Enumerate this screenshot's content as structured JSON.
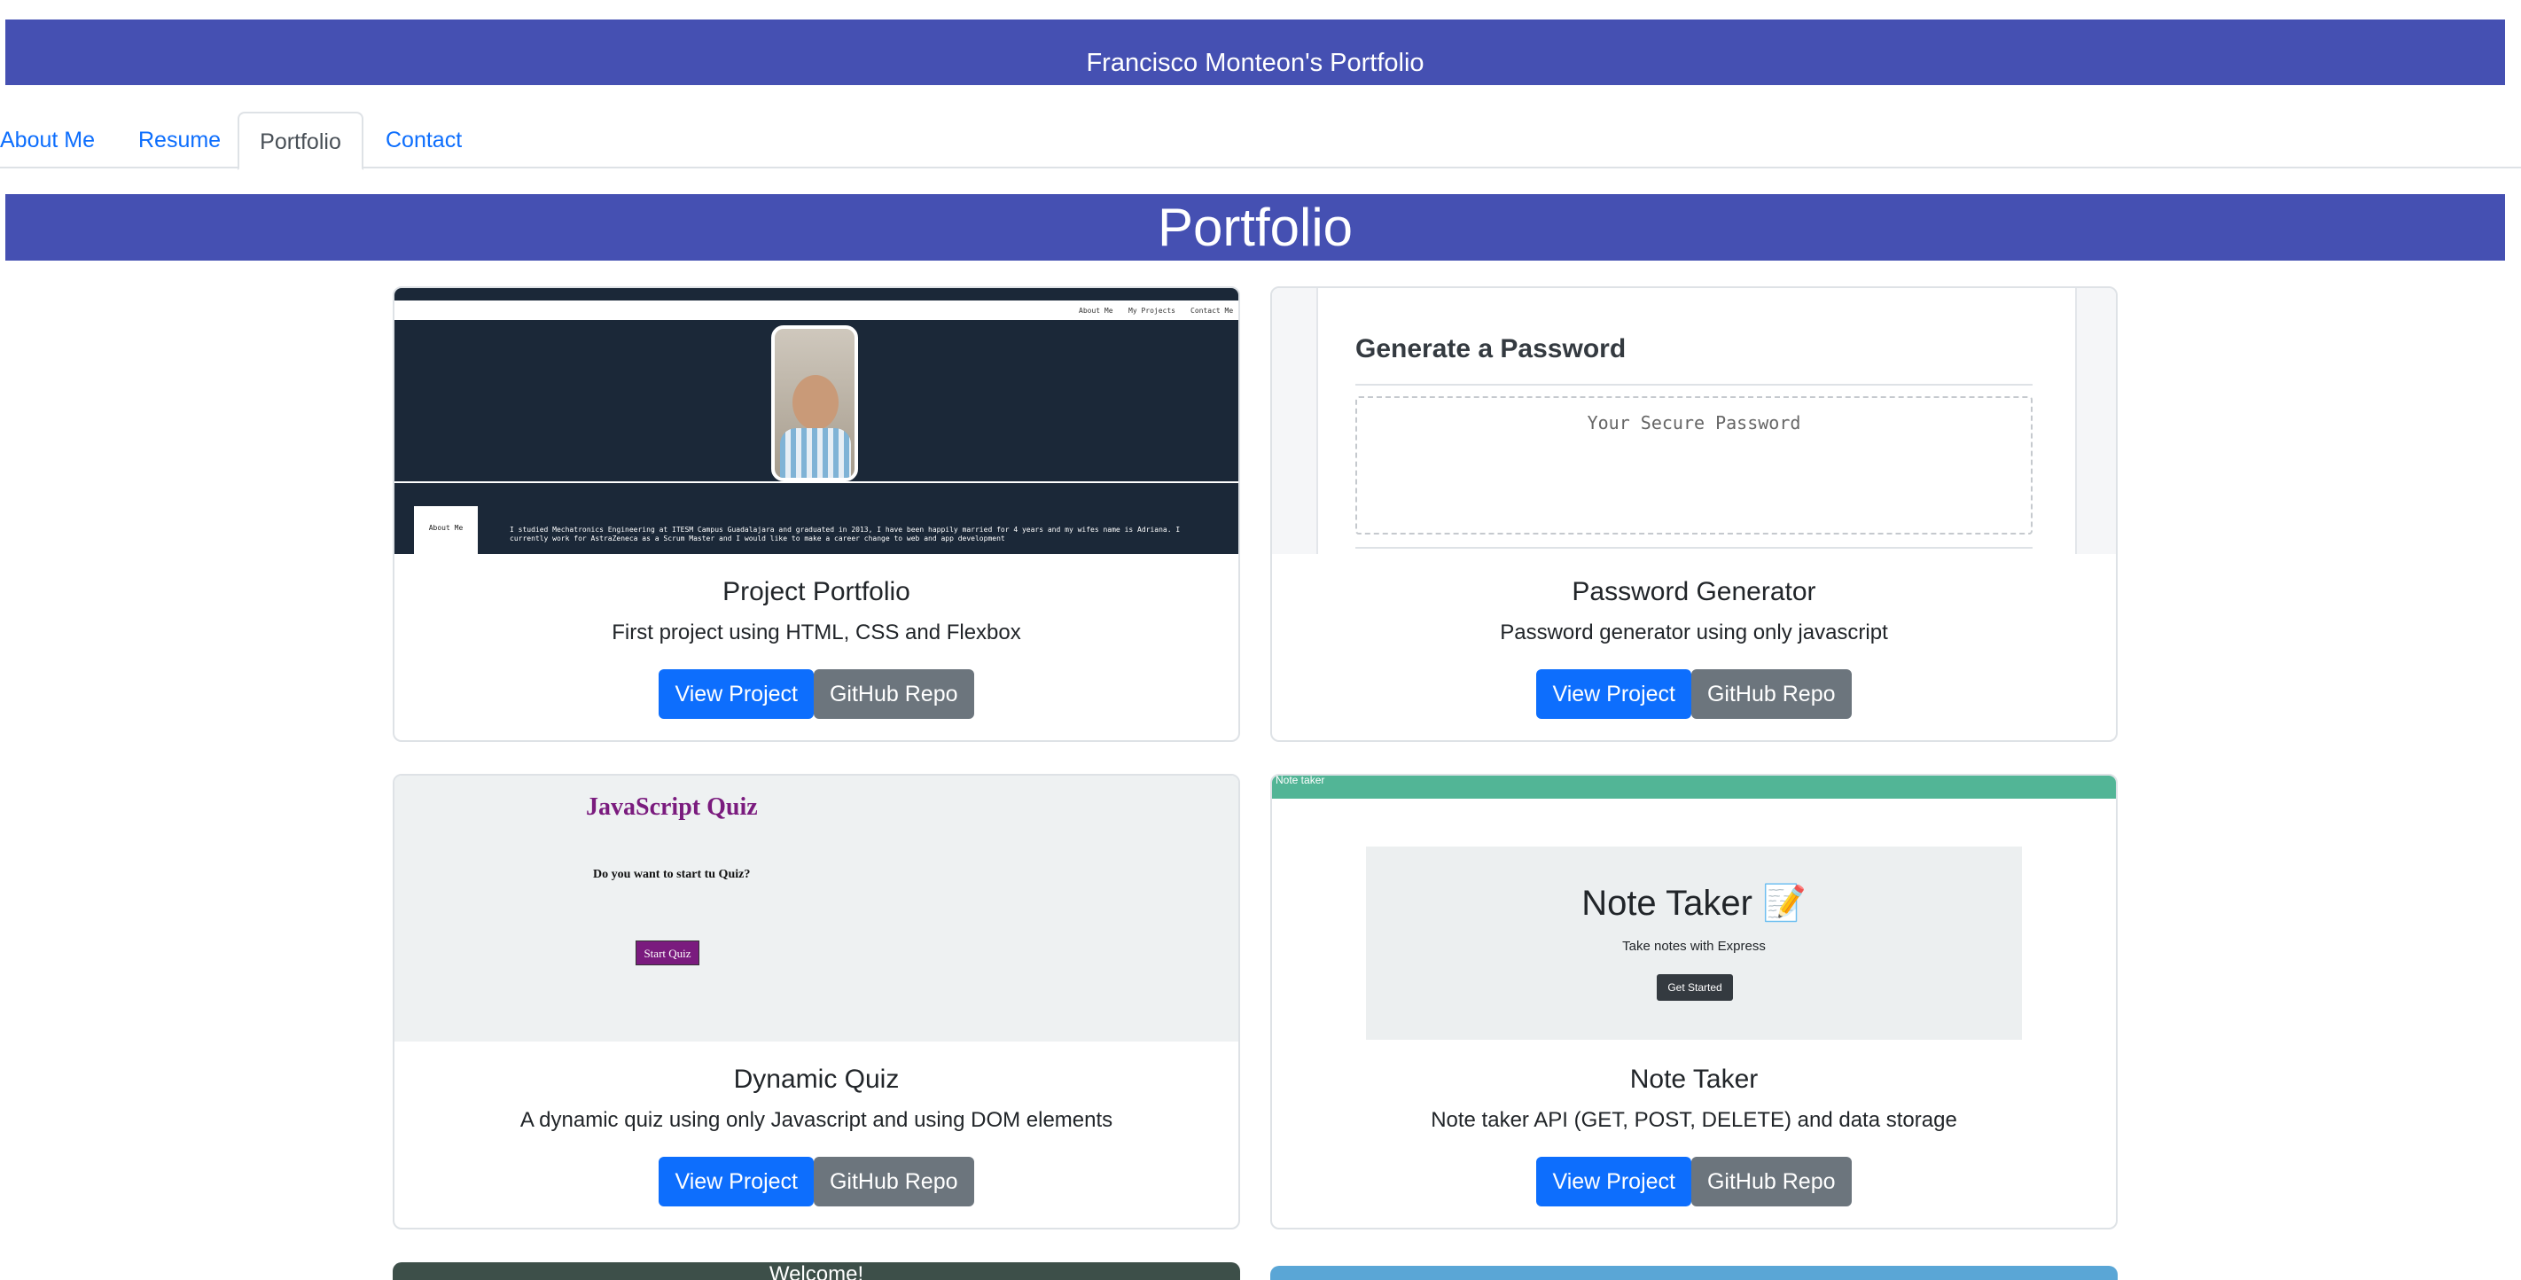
{
  "header": {
    "title": "Francisco Monteon's Portfolio"
  },
  "tabs": [
    {
      "label": "About Me",
      "active": false
    },
    {
      "label": "Resume",
      "active": false
    },
    {
      "label": "Portfolio",
      "active": true
    },
    {
      "label": "Contact",
      "active": false
    }
  ],
  "section": {
    "title": "Portfolio"
  },
  "colors": {
    "brand": "#4550b2",
    "primary": "#0d6efd",
    "secondary": "#6c757d"
  },
  "projects": [
    {
      "title": "Project Portfolio",
      "description": "First project using HTML, CSS and Flexbox",
      "view_label": "View Project",
      "repo_label": "GitHub Repo",
      "thumb": {
        "nav": [
          "About Me",
          "My Projects",
          "Contact Me"
        ],
        "about_label": "About Me",
        "bio": "I studied Mechatronics Engineering at ITESM Campus Guadalajara and graduated in 2013, I have been happily married for 4 years and my wifes name is Adriana. I currently work for AstraZeneca as a Scrum Master and I would like to make a career change to web and app development"
      }
    },
    {
      "title": "Password Generator",
      "description": "Password generator using only javascript",
      "view_label": "View Project",
      "repo_label": "GitHub Repo",
      "thumb": {
        "heading": "Generate a Password",
        "placeholder": "Your Secure Password"
      }
    },
    {
      "title": "Dynamic Quiz",
      "description": "A dynamic quiz using only Javascript and using DOM elements",
      "view_label": "View Project",
      "repo_label": "GitHub Repo",
      "thumb": {
        "heading": "JavaScript Quiz",
        "question": "Do you want to start tu Quiz?",
        "button": "Start Quiz"
      }
    },
    {
      "title": "Note Taker",
      "description": "Note taker API (GET, POST, DELETE) and data storage",
      "view_label": "View Project",
      "repo_label": "GitHub Repo",
      "thumb": {
        "nav": "Note taker",
        "heading": "Note Taker 📝",
        "subtitle": "Take notes with Express",
        "button": "Get Started"
      }
    }
  ],
  "partial_row": {
    "left_title": "Welcome!"
  }
}
